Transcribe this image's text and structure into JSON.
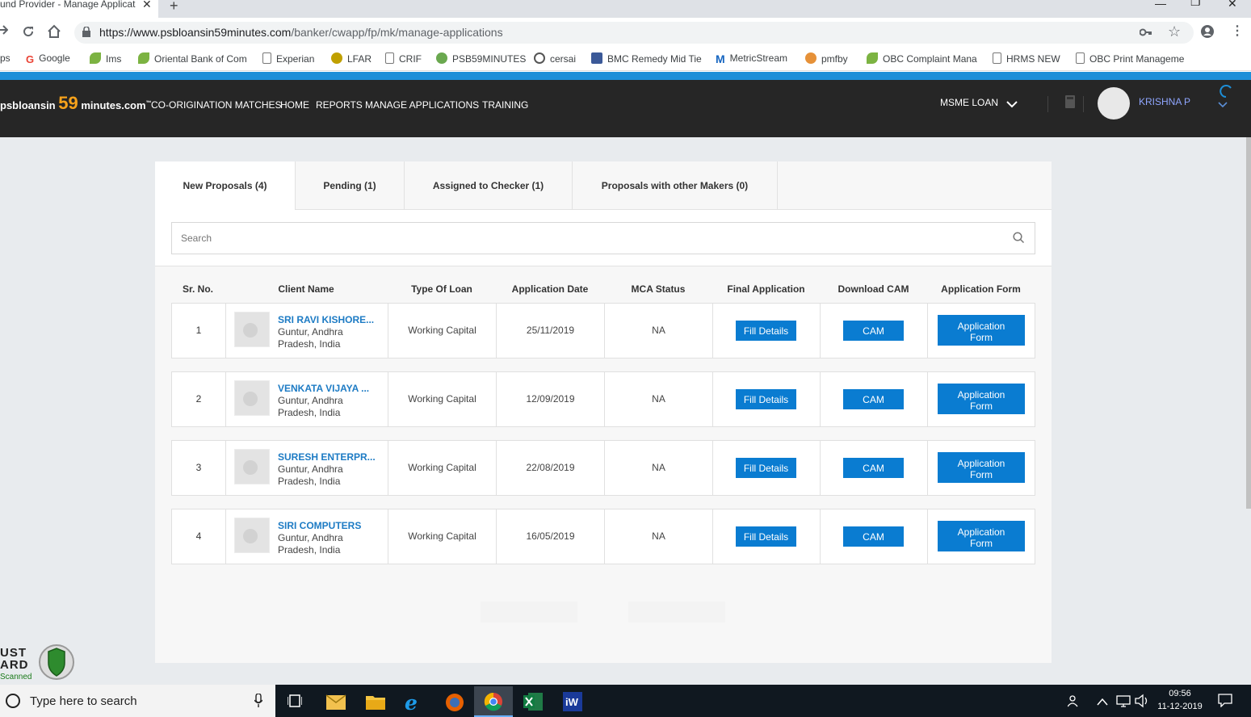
{
  "browser": {
    "tab_title": "und Provider - Manage Applicat",
    "tab_close": "✕",
    "new_tab": "+",
    "url_host": "https://www.psbloansin59minutes.com",
    "url_path": "/banker/cwapp/fp/mk/manage-applications",
    "bookmarks": [
      {
        "label": "ps",
        "icon": "apps-icon",
        "color": "#4285f4"
      },
      {
        "label": "Google",
        "icon": "google-icon",
        "color": "#ea4335"
      },
      {
        "label": "Ims",
        "icon": "leaf-icon",
        "color": "#7cb342"
      },
      {
        "label": "Oriental Bank of Com",
        "icon": "leaf-icon",
        "color": "#7cb342"
      },
      {
        "label": "Experian",
        "icon": "page-icon",
        "color": "#ffffff"
      },
      {
        "label": "LFAR",
        "icon": "globe-icon",
        "color": "#c0a000"
      },
      {
        "label": "CRIF",
        "icon": "page-icon",
        "color": "#ffffff"
      },
      {
        "label": "PSB59MINUTES",
        "icon": "badge-icon",
        "color": "#6aa84f"
      },
      {
        "label": "cersai",
        "icon": "seal-icon",
        "color": "#555555"
      },
      {
        "label": "BMC Remedy Mid Tie",
        "icon": "remedy-icon",
        "color": "#3b5998"
      },
      {
        "label": "MetricStream",
        "icon": "m-icon",
        "color": "#1565c0"
      },
      {
        "label": "pmfby",
        "icon": "crop-icon",
        "color": "#e69138"
      },
      {
        "label": "OBC Complaint Mana",
        "icon": "leaf-icon",
        "color": "#7cb342"
      },
      {
        "label": "HRMS NEW",
        "icon": "page-icon",
        "color": "#ffffff"
      },
      {
        "label": "OBC Print Manageme",
        "icon": "page-icon",
        "color": "#ffffff"
      }
    ]
  },
  "header": {
    "logo_left": "psbloansin",
    "logo_num": "59",
    "logo_right": "minutes.com",
    "logo_tm": "™",
    "nav": [
      "CO-ORIGINATION MATCHES",
      "HOME",
      "REPORTS",
      "MANAGE APPLICATIONS",
      "TRAINING"
    ],
    "loan_type": "MSME LOAN",
    "user_name": "KRISHNA P"
  },
  "tabs": [
    {
      "label": "New Proposals (4)",
      "active": true
    },
    {
      "label": "Pending (1)",
      "active": false
    },
    {
      "label": "Assigned to Checker (1)",
      "active": false
    },
    {
      "label": "Proposals with other Makers (0)",
      "active": false
    }
  ],
  "search": {
    "placeholder": "Search"
  },
  "table": {
    "columns": [
      "Sr. No.",
      "Client Name",
      "Type Of Loan",
      "Application Date",
      "MCA Status",
      "Final Application",
      "Download CAM",
      "Application Form"
    ],
    "rows": [
      {
        "sr": "1",
        "name": "SRI RAVI KISHORE...",
        "addr1": "Guntur, Andhra",
        "addr2": "Pradesh, India",
        "loan": "Working Capital",
        "date": "25/11/2019",
        "mca": "NA",
        "fill": "Fill Details",
        "cam": "CAM",
        "form1": "Application",
        "form2": "Form"
      },
      {
        "sr": "2",
        "name": "VENKATA VIJAYA ...",
        "addr1": "Guntur, Andhra",
        "addr2": "Pradesh, India",
        "loan": "Working Capital",
        "date": "12/09/2019",
        "mca": "NA",
        "fill": "Fill Details",
        "cam": "CAM",
        "form1": "Application",
        "form2": "Form"
      },
      {
        "sr": "3",
        "name": "SURESH ENTERPR...",
        "addr1": "Guntur, Andhra",
        "addr2": "Pradesh, India",
        "loan": "Working Capital",
        "date": "22/08/2019",
        "mca": "NA",
        "fill": "Fill Details",
        "cam": "CAM",
        "form1": "Application",
        "form2": "Form"
      },
      {
        "sr": "4",
        "name": "SIRI COMPUTERS",
        "addr1": "Guntur, Andhra",
        "addr2": "Pradesh, India",
        "loan": "Working Capital",
        "date": "16/05/2019",
        "mca": "NA",
        "fill": "Fill Details",
        "cam": "CAM",
        "form1": "Application",
        "form2": "Form"
      }
    ]
  },
  "trust_badge": {
    "line1": "UST",
    "line2": "ARD",
    "line3": "Scanned"
  },
  "taskbar": {
    "search_placeholder": "Type here to search",
    "time": "09:56",
    "date": "11-12-2019"
  },
  "colors": {
    "accent": "#0a7cd1",
    "header_bg": "#262626",
    "logo_num": "#f7a21b",
    "progress": "#1d8fd8"
  }
}
